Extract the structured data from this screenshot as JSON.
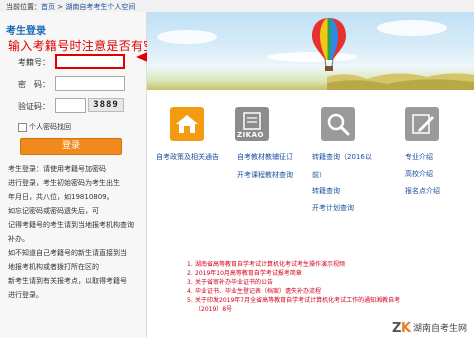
{
  "breadcrumb": {
    "prefix": "当前位置：",
    "home": "首页",
    "sep1": " > ",
    "section": "湖南自考考生个人空间"
  },
  "login": {
    "title": "考生登录",
    "hint": "输入考籍号时注意是否有空格",
    "id_label": "考籍号：",
    "password_label": "密　码：",
    "captcha_label": "验证码：",
    "captcha_text": "3889",
    "forgot_label": "个人密码找回",
    "button_label": "登录",
    "notes": [
      "考生登录：请使用考籍号加密码",
      "进行登录，考生初始密码为考生出生",
      "年月日，共八位，如19810809。",
      "如忘记密码或密码遗失后，可",
      "记得考籍号的考生请到当地报考机构查询",
      "补办。",
      "如不知道自己考籍号的新生请直接到当",
      "地报考机构或者拨打所在区的",
      "新考生请到有关报考点，以取得考籍号",
      "进行登录。"
    ]
  },
  "icons": [
    {
      "name": "home-icon",
      "label": "自考政策及相关通告"
    },
    {
      "name": "zikao-icon",
      "label": "自考教材教辅征订",
      "sub": "ZIKAO"
    },
    {
      "name": "search-icon",
      "label": "转籍查询（2016以"
    },
    {
      "name": "edit-icon",
      "label": "专业介绍"
    }
  ],
  "links": {
    "col2_extra": "开考课程教材查询",
    "col3_extra": [
      "前）",
      "转籍查询",
      "开考计划查询"
    ],
    "col4_extra": [
      "高校介绍",
      "报名点介绍"
    ]
  },
  "news": [
    {
      "num": "1.",
      "text": "湖南省高等教育自学考试计算机化考试考生操作演示视频"
    },
    {
      "num": "2.",
      "text": "2019年10月高等教育自学考试报考简章"
    },
    {
      "num": "3.",
      "text": "关于省审补办毕业证书的公告"
    },
    {
      "num": "4.",
      "text": "毕业证书、毕业生登记表（档案）遗失补办流程"
    },
    {
      "num": "5.",
      "text": "关于印发2019年7月全省高等教育自学考试计算机化考试工作的通知湘教自考"
    },
    {
      "num": "",
      "text": "〔2019〕8号"
    }
  ],
  "watermark": "湖南自考生网",
  "colors": {
    "accent_red": "#e00000",
    "login_orange": "#f08a1c",
    "link_blue": "#1a4f9c",
    "icon_orange": "#f39c12",
    "icon_gray": "#8c8c8c"
  }
}
